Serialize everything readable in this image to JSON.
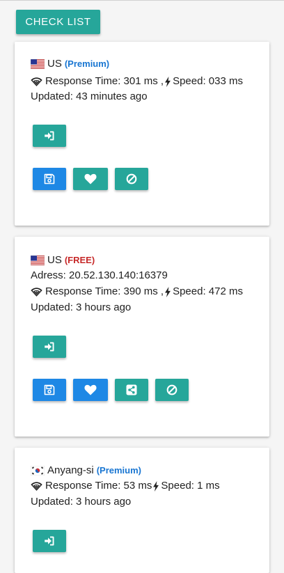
{
  "toolbar": {
    "check_list_label": "CHECK LIST"
  },
  "cards": [
    {
      "country": "US",
      "tier": "(Premium)",
      "response_label": "Response Time: 301 ms ,",
      "speed_label": "Speed: 033 ms",
      "updated": "Updated: 43 minutes ago",
      "flag": "us-flag",
      "actions": [
        "connect-icon",
        "save-icon",
        "heart-icon",
        "block-icon"
      ]
    },
    {
      "country": "US",
      "tier": "(FREE)",
      "address": "Adress: 20.52.130.140:16379",
      "response_label": "Response Time: 390 ms ,",
      "speed_label": "Speed: 472 ms",
      "updated": "Updated: 3 hours ago",
      "flag": "us-flag",
      "actions": [
        "connect-icon",
        "save-icon",
        "heart-icon",
        "share-icon",
        "block-icon"
      ]
    },
    {
      "country": "Anyang-si",
      "tier": "(Premium)",
      "response_label": "Response Time: 53 ms ",
      "speed_label": "Speed: 1 ms",
      "updated": "Updated: 3 hours ago",
      "flag": "south-korea-flag",
      "actions": [
        "connect-icon"
      ]
    }
  ],
  "colors": {
    "teal": "#26a69a",
    "blue": "#1e88e5",
    "premium": "#1976d2",
    "free": "#c62828"
  }
}
